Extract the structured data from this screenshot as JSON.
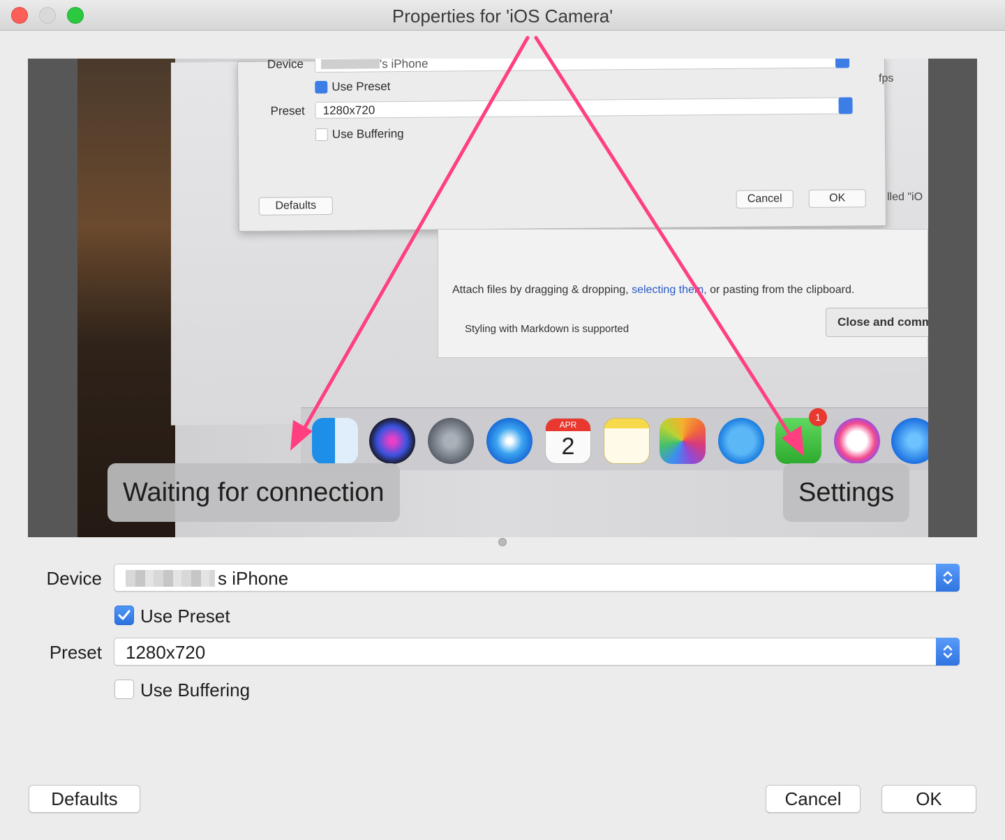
{
  "window": {
    "title": "Properties for 'iOS Camera'"
  },
  "preview": {
    "overlay_left": "Waiting for connection",
    "overlay_right": "Settings",
    "photo": {
      "dialog_device_label": "Device",
      "dialog_device_value": "'s iPhone",
      "dialog_use_preset": "Use Preset",
      "dialog_preset_label": "Preset",
      "dialog_preset_value": "1280x720",
      "dialog_use_buffering": "Use Buffering",
      "dialog_defaults": "Defaults",
      "dialog_cancel": "Cancel",
      "dialog_ok": "OK",
      "page_attach_prefix": "Attach files by dragging & dropping,",
      "page_attach_link": "selecting them,",
      "page_attach_suffix": "or pasting from the clipboard.",
      "page_markdown": "Styling with Markdown is supported",
      "page_close_button": "Close and comm",
      "side_fps": "fps",
      "side_called": "lled \"iO",
      "dock_calendar_month": "APR",
      "dock_calendar_day": "2",
      "dock_facetime_badge": "1"
    },
    "dock_icons": [
      "finder-icon",
      "siri-icon",
      "launchpad-icon",
      "safari-icon",
      "calendar-icon",
      "notes-icon",
      "photos-icon",
      "messages-icon",
      "facetime-icon",
      "itunes-icon",
      "app-store-icon"
    ]
  },
  "form": {
    "device_label": "Device",
    "device_value_suffix": "s iPhone",
    "use_preset_label": "Use Preset",
    "use_preset_checked": true,
    "preset_label": "Preset",
    "preset_value": "1280x720",
    "use_buffering_label": "Use Buffering",
    "use_buffering_checked": false
  },
  "buttons": {
    "defaults": "Defaults",
    "cancel": "Cancel",
    "ok": "OK"
  },
  "colors": {
    "accent": "#2f74e0",
    "arrow": "#ff3f7f",
    "close": "#fc5f57",
    "maximize": "#2ac940"
  }
}
